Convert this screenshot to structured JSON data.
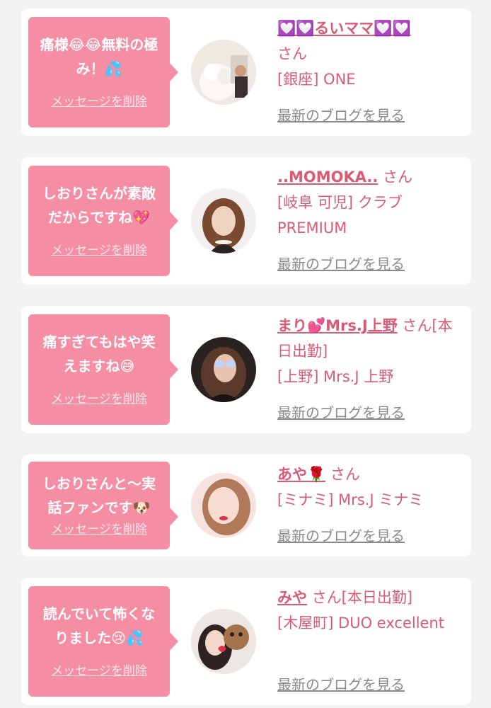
{
  "items": [
    {
      "message": "痛様😂😂無料の極み！💦",
      "delete_label": "メッセージを削除",
      "name": "💟💟るいママ💟💟",
      "san": "さん",
      "shop": "[銀座] ONE",
      "blog_label": "最新のブログを見る"
    },
    {
      "message": "しおりさんが素敵だからですね💖",
      "delete_label": "メッセージを削除",
      "name": "..MOMOKA..",
      "san": "さん",
      "shop": "[岐阜 可児] クラブ PREMIUM",
      "blog_label": "最新のブログを見る"
    },
    {
      "message": "痛すぎてもはや笑えますね😅",
      "delete_label": "メッセージを削除",
      "name": "まり💕Mrs.J上野",
      "san": "さん[本日出勤]",
      "shop": "[上野] Mrs.J 上野",
      "blog_label": "最新のブログを見る"
    },
    {
      "message": "しおりさんと〜実話ファンです🐶",
      "delete_label": "メッセージを削除",
      "name": "あや🌹",
      "san": "さん",
      "shop": "[ミナミ] Mrs.J ミナミ",
      "blog_label": "最新のブログを見る"
    },
    {
      "message": "読んでいて怖くなりました😢💦",
      "delete_label": "メッセージを削除",
      "name": "みや",
      "san": "さん[本日出勤]",
      "shop": "[木屋町] DUO excellent",
      "blog_label": "最新のブログを見る"
    }
  ]
}
